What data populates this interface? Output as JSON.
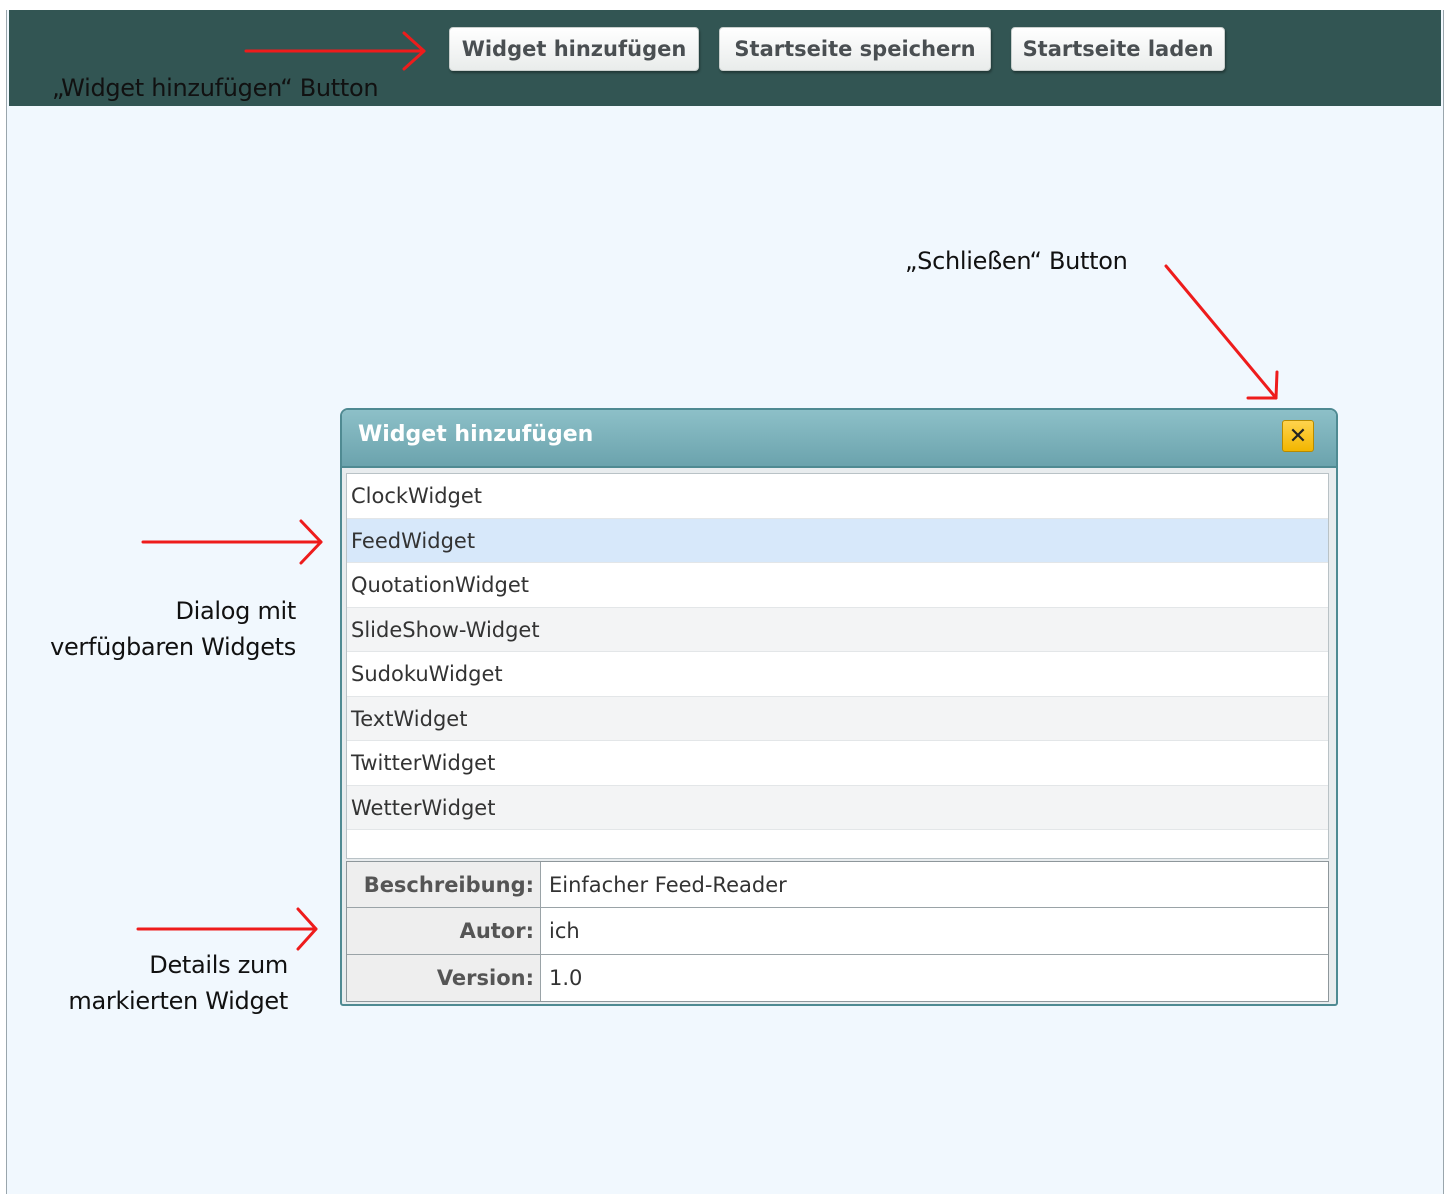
{
  "toolbar": {
    "buttons": [
      {
        "label": "Widget hinzufügen"
      },
      {
        "label": "Startseite speichern"
      },
      {
        "label": "Startseite laden"
      }
    ]
  },
  "annotations": {
    "add_button": "„Widget hinzufügen“ Button",
    "close_button": "„Schließen“ Button",
    "dialog_line1": "Dialog mit",
    "dialog_line2": "verfügbaren Widgets",
    "details_line1": "Details zum",
    "details_line2": "markierten Widget",
    "arrow_color": "#ee1c1c"
  },
  "dialog": {
    "title": "Widget hinzufügen",
    "close_symbol": "✕",
    "widgets": [
      "ClockWidget",
      "FeedWidget",
      "QuotationWidget",
      "SlideShow-Widget",
      "SudokuWidget",
      "TextWidget",
      "TwitterWidget",
      "WetterWidget"
    ],
    "selected_widget": "FeedWidget",
    "details": [
      {
        "label": "Beschreibung:",
        "value": "Einfacher Feed-Reader"
      },
      {
        "label": "Autor:",
        "value": "ich"
      },
      {
        "label": "Version:",
        "value": "1.0"
      }
    ]
  }
}
